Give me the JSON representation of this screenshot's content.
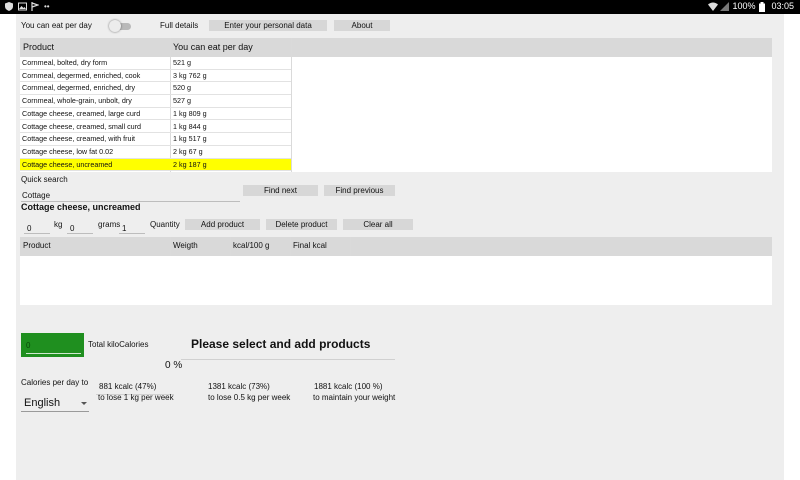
{
  "status_bar": {
    "battery": "100%",
    "time": "03:05",
    "icons": [
      "shield-icon",
      "image-icon",
      "flag-icon",
      "dots-icon",
      "wifi-icon",
      "signal-icon",
      "battery-icon"
    ]
  },
  "top_bar": {
    "toggle_label": "You can eat per day",
    "full_details": "Full details",
    "personal_data_button": "Enter your personal data",
    "about_button": "About"
  },
  "products_table": {
    "headers": [
      "Product",
      "You can eat per day"
    ],
    "rows": [
      {
        "product": "Cornmeal, bolted, dry form",
        "amount": "521 g"
      },
      {
        "product": "Cornmeal, degermed, enriched, cook",
        "amount": "3 kg 762 g"
      },
      {
        "product": "Cornmeal, degermed, enriched, dry",
        "amount": "520 g"
      },
      {
        "product": "Cornmeal, whole-grain, unbolt, dry",
        "amount": "527 g"
      },
      {
        "product": "Cottage cheese, creamed, large curd",
        "amount": "1 kg 809 g"
      },
      {
        "product": "Cottage cheese, creamed, small curd",
        "amount": "1 kg 844 g"
      },
      {
        "product": "Cottage cheese, creamed, with fruit",
        "amount": "1 kg 517 g"
      },
      {
        "product": "Cottage cheese, low fat 0.02",
        "amount": "2 kg 67 g"
      },
      {
        "product": "Cottage cheese, uncreamed",
        "amount": "2 kg 187 g"
      }
    ],
    "selected_index": 8,
    "highlight_color": "#ffff00"
  },
  "search": {
    "label": "Quick search",
    "value": "Cottage",
    "find_next": "Find next",
    "find_previous": "Find previous"
  },
  "selected_product": "Cottage cheese, uncreamed",
  "quantity": {
    "kg_value": "0",
    "kg_label": "kg",
    "grams_value": "0",
    "grams_label": "grams",
    "extra_value": "1",
    "label": "Quantity",
    "add_button": "Add product",
    "delete_button": "Delete product",
    "clear_button": "Clear all"
  },
  "added_table": {
    "headers": [
      "Product",
      "Weigth",
      "kcal/100 g",
      "Final kcal"
    ]
  },
  "totals": {
    "value": "0",
    "label": "Total kiloCalories",
    "box_color": "#1f8f1f",
    "message": "Please select and add products",
    "percent": "0 %"
  },
  "calories": {
    "label": "Calories per day to",
    "options": [
      {
        "kcal": "881 kcalc (47%)",
        "goal": "to lose 1 kg per week"
      },
      {
        "kcal": "1381 kcalc (73%)",
        "goal": "to lose 0.5 kg per week"
      },
      {
        "kcal": "1881 kcalc (100 %)",
        "goal": "to maintain your weight"
      }
    ]
  },
  "language": {
    "selected": "English"
  }
}
